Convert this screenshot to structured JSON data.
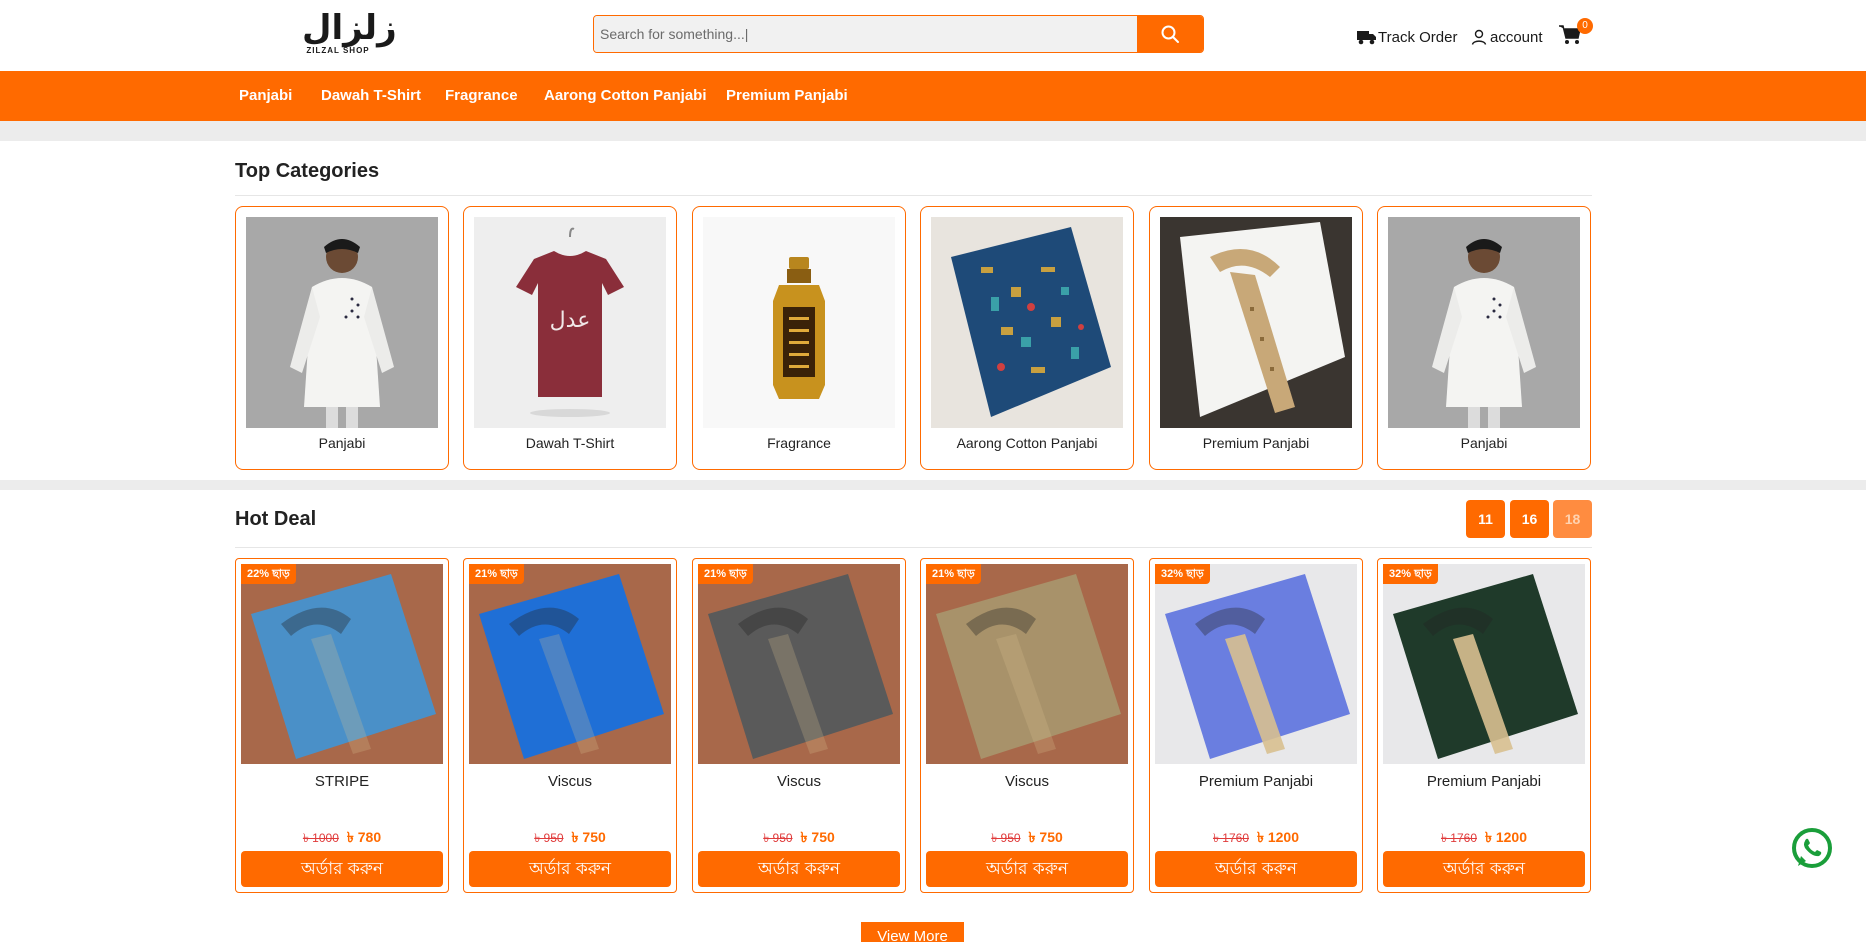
{
  "header": {
    "logo_arabic": "زلزال",
    "logo_english": "ZILZAL SHOP",
    "search_placeholder": "Search for something...|",
    "track_order_label": "Track Order",
    "account_label": "account",
    "cart_count": "0"
  },
  "nav": {
    "items": [
      {
        "label": "Panjabi"
      },
      {
        "label": "Dawah T-Shirt"
      },
      {
        "label": "Fragrance"
      },
      {
        "label": "Aarong Cotton Panjabi"
      },
      {
        "label": "Premium Panjabi"
      }
    ]
  },
  "top_categories": {
    "title": "Top Categories",
    "items": [
      {
        "name": "Panjabi",
        "image": "white-panjabi-model-photo"
      },
      {
        "name": "Dawah T-Shirt",
        "image": "maroon-tshirt-photo"
      },
      {
        "name": "Fragrance",
        "image": "attar-bottle-photo"
      },
      {
        "name": "Aarong Cotton Panjabi",
        "image": "blue-printed-panjabi-photo"
      },
      {
        "name": "Premium Panjabi",
        "image": "white-embroidered-panjabi-photo"
      },
      {
        "name": "Panjabi",
        "image": "white-panjabi-model-photo"
      }
    ]
  },
  "hot_deal": {
    "title": "Hot Deal",
    "countdown": [
      "11",
      "16",
      "18"
    ],
    "order_label": "অর্ডার করুন",
    "items": [
      {
        "badge": "22% ছাড়",
        "name": "STRIPE",
        "old_price": "৳ 1000",
        "new_price": "৳ 780",
        "color": "#4a90c8"
      },
      {
        "badge": "21% ছাড়",
        "name": "Viscus",
        "old_price": "৳ 950",
        "new_price": "৳ 750",
        "color": "#1f6fd6"
      },
      {
        "badge": "21% ছাড়",
        "name": "Viscus",
        "old_price": "৳ 950",
        "new_price": "৳ 750",
        "color": "#5a5a5a"
      },
      {
        "badge": "21% ছাড়",
        "name": "Viscus",
        "old_price": "৳ 950",
        "new_price": "৳ 750",
        "color": "#a8926a"
      },
      {
        "badge": "32% ছাড়",
        "name": "Premium Panjabi",
        "old_price": "৳ 1760",
        "new_price": "৳ 1200",
        "color": "#6a7ee0"
      },
      {
        "badge": "32% ছাড়",
        "name": "Premium Panjabi",
        "old_price": "৳ 1760",
        "new_price": "৳ 1200",
        "color": "#1f3a2a"
      }
    ]
  },
  "view_more_label": "View More",
  "colors": {
    "accent": "#ff6a00",
    "strike": "#e03a3a",
    "whatsapp": "#1a9e3a"
  }
}
